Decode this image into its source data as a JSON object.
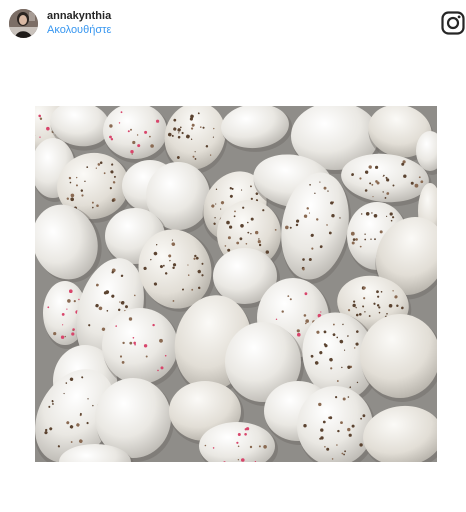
{
  "post": {
    "username": "annakynthia",
    "follow_label": "Ακολουθήστε",
    "platform_icon": "instagram-icon",
    "accent_color": "#3897f0"
  },
  "photo": {
    "subject_icon": "speckled-candy-eggs-photo"
  }
}
